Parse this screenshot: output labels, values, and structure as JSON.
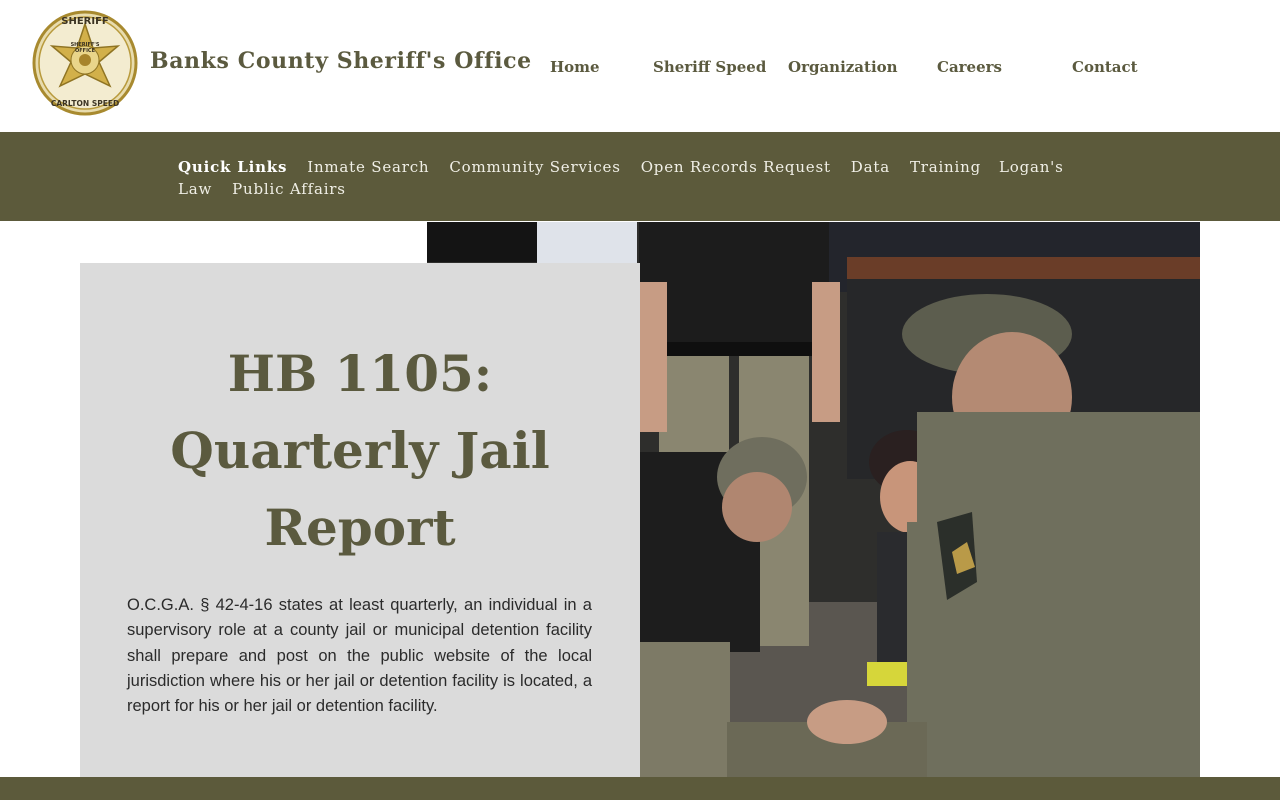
{
  "site": {
    "title": "Banks County Sheriff's Office",
    "logo": {
      "top_text": "SHERIFF",
      "center_text_1": "SHERIFF'S",
      "center_text_2": "OFFICE",
      "bottom_text": "CARLTON SPEED"
    }
  },
  "main_nav": [
    "Home",
    "Sheriff Speed",
    "Organization",
    "Careers",
    "Contact"
  ],
  "quick_links": {
    "title": "Quick Links",
    "items": [
      "Inmate Search",
      "Community Services",
      "Open Records Request",
      "Data",
      "Training",
      "Logan's Law",
      "Public Affairs"
    ]
  },
  "hero": {
    "title_line1": "HB 1105:",
    "title_line2": "Quarterly Jail",
    "title_line3": "Report",
    "body": "O.C.G.A. § 42-4-16 states at least quarterly, an individual in a supervisory role at a county jail or municipal detention facility shall prepare and post on the public website of the local jurisdiction where his or her jail or detention facility is located, a report for his or her jail or detention facility."
  },
  "colors": {
    "brand_olive": "#5c5a3b",
    "title_text": "#5b5a3f",
    "card_bg": "#dbdbdb",
    "badge_gold": "#c9a63a"
  }
}
